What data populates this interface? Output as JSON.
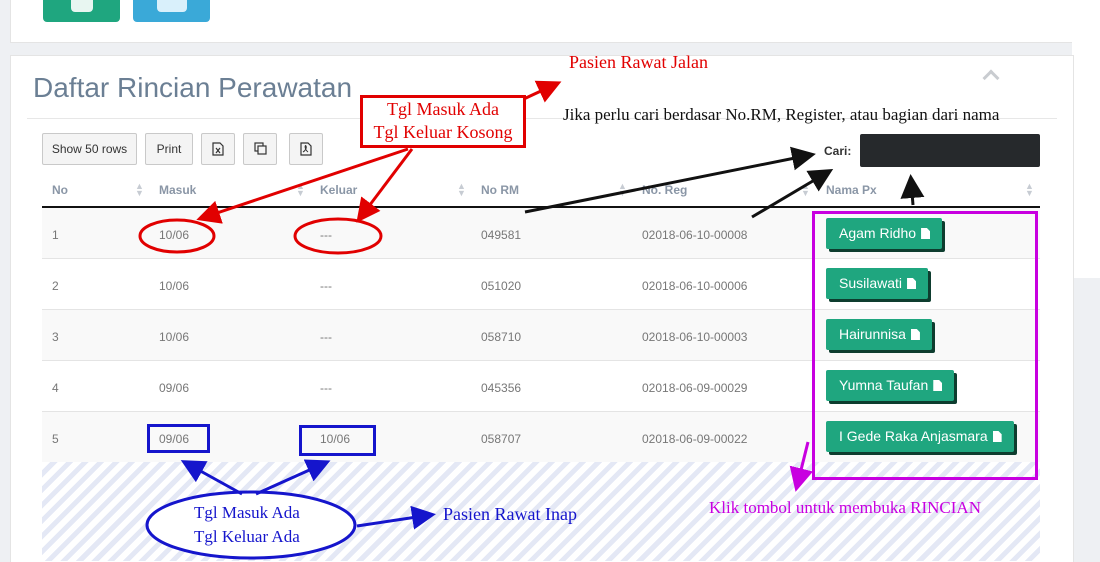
{
  "panel": {
    "title": "Daftar Rincian Perawatan"
  },
  "toolbar": {
    "show_rows": "Show 50 rows",
    "print": "Print",
    "search_label": "Cari:",
    "search_value": ""
  },
  "columns": [
    "No",
    "Masuk",
    "Keluar",
    "No RM",
    "No. Reg",
    "Nama Px"
  ],
  "rows": [
    {
      "no": "1",
      "masuk": "10/06",
      "keluar": "---",
      "no_rm": "049581",
      "no_reg": "02018-06-10-00008",
      "nama": "Agam Ridho"
    },
    {
      "no": "2",
      "masuk": "10/06",
      "keluar": "---",
      "no_rm": "051020",
      "no_reg": "02018-06-10-00006",
      "nama": "Susilawati"
    },
    {
      "no": "3",
      "masuk": "10/06",
      "keluar": "---",
      "no_rm": "058710",
      "no_reg": "02018-06-10-00003",
      "nama": "Hairunnisa"
    },
    {
      "no": "4",
      "masuk": "09/06",
      "keluar": "---",
      "no_rm": "045356",
      "no_reg": "02018-06-09-00029",
      "nama": "Yumna Taufan"
    },
    {
      "no": "5",
      "masuk": "09/06",
      "keluar": "10/06",
      "no_rm": "058707",
      "no_reg": "02018-06-09-00022",
      "nama": "I Gede Raka Anjasmara"
    }
  ],
  "annotations": {
    "rawat_jalan": "Pasien Rawat Jalan",
    "red_box_line1": "Tgl Masuk Ada",
    "red_box_line2": "Tgl Keluar Kosong",
    "search_hint": "Jika perlu cari berdasar No.RM, Register, atau bagian dari nama",
    "blue_ellipse_line1": "Tgl Masuk Ada",
    "blue_ellipse_line2": "Tgl Keluar Ada",
    "rawat_inap": "Pasien Rawat Inap",
    "klik": "Klik tombol untuk membuka RINCIAN"
  },
  "colors": {
    "button_green": "#1fa67f",
    "annotation_red": "#e10000",
    "annotation_blue": "#1515cc",
    "annotation_purple": "#c800e0"
  },
  "icons": [
    "excel-icon",
    "copy-icon",
    "pdf-icon",
    "file-icon",
    "chevron-up-icon",
    "sort-icon"
  ]
}
